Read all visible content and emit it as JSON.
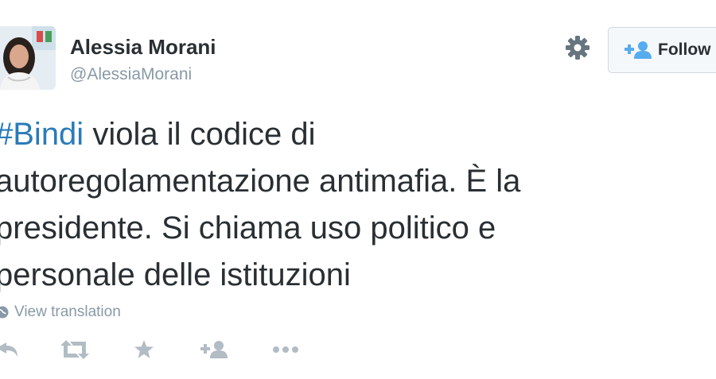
{
  "author": {
    "name": "Alessia Morani",
    "handle": "@AlessiaMorani",
    "avatar_icon": "profile-photo"
  },
  "header": {
    "settings_icon": "gear-icon",
    "follow_icon": "add-user-icon",
    "follow_label": "Follow"
  },
  "tweet": {
    "hashtag": "#Bindi",
    "lines": [
      " viola il codice di",
      "autoregolamentazione antimafia. È la",
      "presidente. Si chiama uso politico e",
      "personale delle istituzioni"
    ]
  },
  "translation": {
    "icon": "globe-icon",
    "label": "View translation"
  },
  "actions": {
    "icons": [
      "reply-icon",
      "retweet-icon",
      "favorite-icon",
      "follow-icon",
      "more-icon"
    ]
  },
  "colors": {
    "hashtag": "#2b7bb9",
    "muted": "#8899a6",
    "text": "#292f33",
    "follow_icon": "#55acee"
  }
}
